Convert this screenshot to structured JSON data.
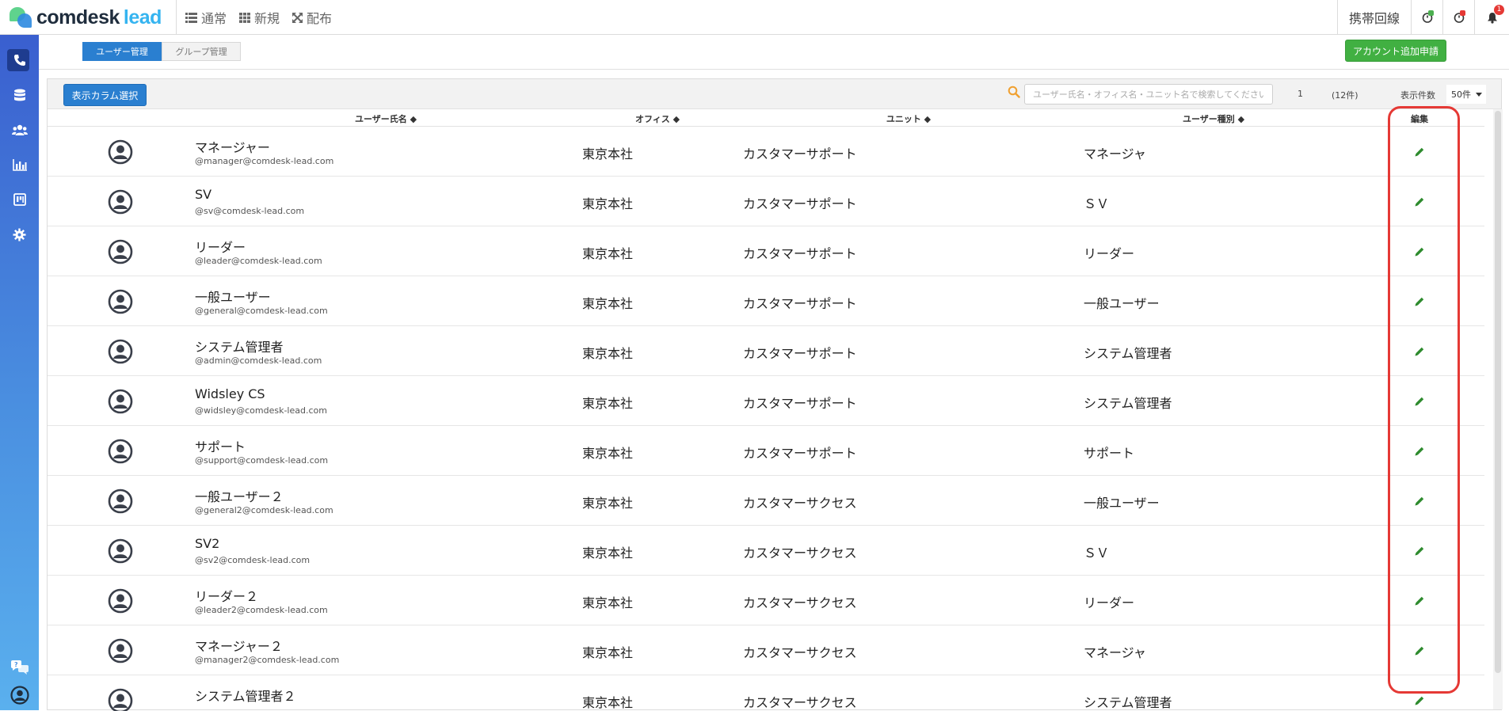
{
  "app": {
    "logo_text_main": "comdesk",
    "logo_text_accent": "lead"
  },
  "topnav": [
    {
      "label": "通常",
      "icon": "list-icon"
    },
    {
      "label": "新規",
      "icon": "grid-icon"
    },
    {
      "label": "配布",
      "icon": "expand-arrows-icon"
    }
  ],
  "top_right": {
    "mobile_line_label": "携帯回線",
    "notification_count": "1",
    "status_icon_1_color": "#4caf50",
    "status_icon_2_color": "#e53935"
  },
  "sidebar": [
    {
      "name": "phone-icon",
      "active": true
    },
    {
      "name": "database-icon",
      "active": false
    },
    {
      "name": "users-icon",
      "active": false
    },
    {
      "name": "bar-chart-icon",
      "active": false
    },
    {
      "name": "board-icon",
      "active": false
    },
    {
      "name": "gear-icon",
      "active": false
    },
    {
      "name": "help-chat-icon",
      "active": false
    },
    {
      "name": "user-account-icon",
      "active": false
    }
  ],
  "tabs": {
    "users": "ユーザー管理",
    "groups": "グループ管理"
  },
  "add_account_button": "アカウント追加申請",
  "toolbar": {
    "columns_button": "表示カラム選択",
    "search_placeholder": "ユーザー氏名・オフィス名・ユニット名で検索してください",
    "page": "1",
    "total": "(12件)",
    "per_page_label": "表示件数",
    "per_page_value": "50件"
  },
  "table": {
    "headers": {
      "name": "ユーザー氏名 ◆",
      "office": "オフィス ◆",
      "unit": "ユニット ◆",
      "type": "ユーザー種別 ◆",
      "edit": "編集"
    },
    "rows": [
      {
        "name": "マネージャー",
        "email": "@manager@comdesk-lead.com",
        "office": "東京本社",
        "unit": "カスタマーサポート",
        "type": "マネージャ"
      },
      {
        "name": "SV",
        "email": "@sv@comdesk-lead.com",
        "office": "東京本社",
        "unit": "カスタマーサポート",
        "type": "ＳＶ"
      },
      {
        "name": "リーダー",
        "email": "@leader@comdesk-lead.com",
        "office": "東京本社",
        "unit": "カスタマーサポート",
        "type": "リーダー"
      },
      {
        "name": "一般ユーザー",
        "email": "@general@comdesk-lead.com",
        "office": "東京本社",
        "unit": "カスタマーサポート",
        "type": "一般ユーザー"
      },
      {
        "name": "システム管理者",
        "email": "@admin@comdesk-lead.com",
        "office": "東京本社",
        "unit": "カスタマーサポート",
        "type": "システム管理者"
      },
      {
        "name": "Widsley CS",
        "email": "@widsley@comdesk-lead.com",
        "office": "東京本社",
        "unit": "カスタマーサポート",
        "type": "システム管理者"
      },
      {
        "name": "サポート",
        "email": "@support@comdesk-lead.com",
        "office": "東京本社",
        "unit": "カスタマーサポート",
        "type": "サポート"
      },
      {
        "name": "一般ユーザー２",
        "email": "@general2@comdesk-lead.com",
        "office": "東京本社",
        "unit": "カスタマーサクセス",
        "type": "一般ユーザー"
      },
      {
        "name": "SV2",
        "email": "@sv2@comdesk-lead.com",
        "office": "東京本社",
        "unit": "カスタマーサクセス",
        "type": "ＳＶ"
      },
      {
        "name": "リーダー２",
        "email": "@leader2@comdesk-lead.com",
        "office": "東京本社",
        "unit": "カスタマーサクセス",
        "type": "リーダー"
      },
      {
        "name": "マネージャー２",
        "email": "@manager2@comdesk-lead.com",
        "office": "東京本社",
        "unit": "カスタマーサクセス",
        "type": "マネージャ"
      },
      {
        "name": "システム管理者２",
        "email": "",
        "office": "東京本社",
        "unit": "カスタマーサクセス",
        "type": "システム管理者"
      }
    ]
  },
  "colors": {
    "primary": "#2a7fd0",
    "success": "#41b042",
    "edit_icon": "#2e8b2e",
    "highlight": "#e53935"
  }
}
